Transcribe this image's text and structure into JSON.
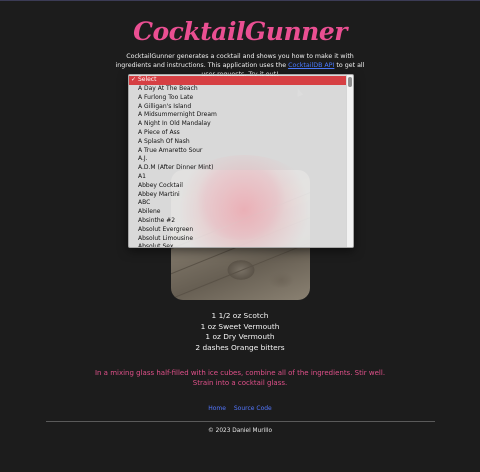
{
  "app": {
    "title": "CocktailGunner",
    "intro_1": "CocktailGunner generates a cocktail and shows you how to make it with ingredients and instructions. This application uses the ",
    "intro_link": "CocktailDB API",
    "intro_2": " to get all user requests. Try it out!"
  },
  "dropdown": {
    "selected": "Select",
    "options": [
      "A Day At The Beach",
      "A Furlong Too Late",
      "A Gilligan's Island",
      "A Midsummernight Dream",
      "A Night In Old Mandalay",
      "A Piece of Ass",
      "A Splash Of Nash",
      "A True Amaretto Sour",
      "A.J.",
      "A.D.M (After Dinner Mint)",
      "A1",
      "Abbey Cocktail",
      "Abbey Martini",
      "ABC",
      "Abilene",
      "Absinthe #2",
      "Absolut Evergreen",
      "Absolut Limousine",
      "Absolut Sex"
    ]
  },
  "cocktail": {
    "ingredients": [
      "1 1/2 oz Scotch",
      "1 oz Sweet Vermouth",
      "1 oz Dry Vermouth",
      "2 dashes Orange bitters"
    ],
    "instructions": "In a mixing glass half-filled with ice cubes, combine all of the ingredients. Stir well. Strain into a cocktail glass."
  },
  "nav": {
    "home": "Home",
    "source": "Source Code"
  },
  "footer": {
    "copyright": "© 2023 Daniel Murillo"
  }
}
